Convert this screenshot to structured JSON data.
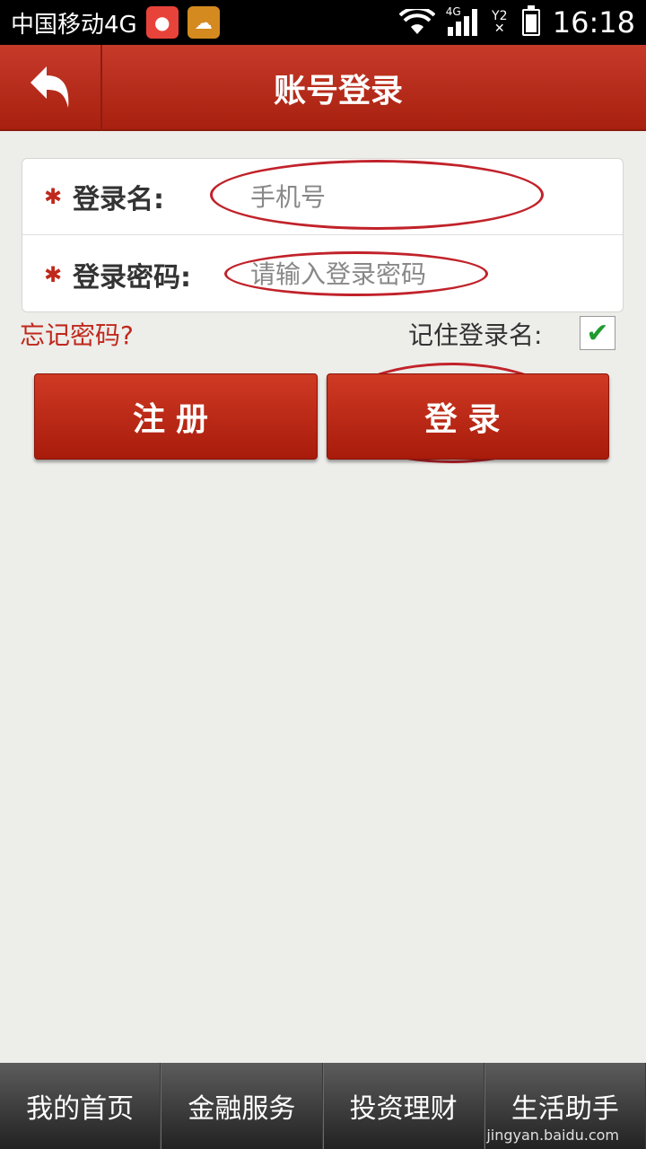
{
  "status_bar": {
    "carrier": "中国移动4G",
    "network_tag": "4G",
    "sim2_tag": "Y2",
    "time": "16:18"
  },
  "header": {
    "title": "账号登录"
  },
  "form": {
    "username": {
      "label": "登录名:",
      "placeholder": "手机号"
    },
    "password": {
      "label": "登录密码:",
      "placeholder": "请输入登录密码"
    }
  },
  "forgot_password": "忘记密码?",
  "remember": {
    "label": "记住登录名:",
    "checked": true
  },
  "buttons": {
    "register": "注册",
    "login": "登录"
  },
  "bottom_nav": {
    "items": [
      "我的首页",
      "金融服务",
      "投资理财",
      "生活助手"
    ]
  },
  "watermark": "jingyan.baidu.com",
  "colors": {
    "brand_red": "#b8281a",
    "annotation_red": "#c1222a",
    "check_green": "#1e9b2f"
  }
}
